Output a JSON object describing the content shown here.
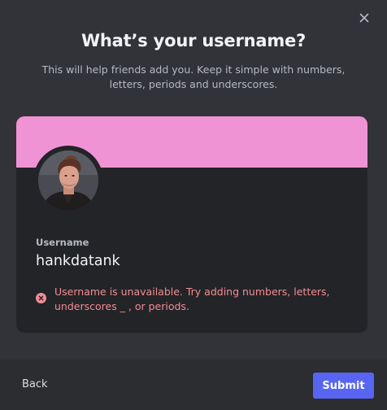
{
  "modal": {
    "title": "What’s your username?",
    "subtitle": "This will help friends add you. Keep it simple with numbers, letters, periods and underscores.",
    "close_icon": "close-icon"
  },
  "profile_card": {
    "banner_color": "#f093d4",
    "field_label": "Username",
    "username_value": "hankdatank",
    "error_message": "Username is unavailable. Try adding numbers, letters, underscores _ , or periods.",
    "error_color": "#f38d93",
    "error_icon": "error-circle-x-icon"
  },
  "footer": {
    "back_label": "Back",
    "submit_label": "Submit",
    "accent_color": "#5865f2"
  }
}
